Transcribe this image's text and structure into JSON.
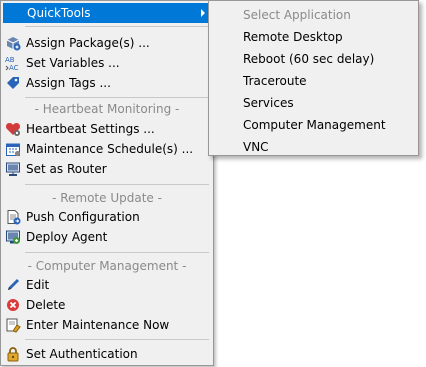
{
  "menu": {
    "quicktools": "QuickTools",
    "assign_packages": "Assign Package(s) ...",
    "set_variables": "Set Variables ...",
    "assign_tags": "Assign Tags ...",
    "heartbeat_header": "- Heartbeat Monitoring -",
    "heartbeat_settings": "Heartbeat Settings ...",
    "maintenance_schedule": "Maintenance Schedule(s) ...",
    "set_as_router": "Set as Router",
    "remote_update_header": "- Remote Update -",
    "push_configuration": "Push Configuration",
    "deploy_agent": "Deploy Agent",
    "computer_mgmt_header": "- Computer Management -",
    "edit": "Edit",
    "delete": "Delete",
    "enter_maintenance": "Enter Maintenance Now",
    "set_authentication": "Set Authentication"
  },
  "submenu": {
    "select_application": "Select Application",
    "remote_desktop": "Remote Desktop",
    "reboot": "Reboot (60 sec delay)",
    "traceroute": "Traceroute",
    "services": "Services",
    "computer_management": "Computer Management",
    "vnc": "VNC"
  },
  "colors": {
    "highlight": "#0078d7",
    "menu_bg": "#f0f0f0",
    "disabled_text": "#8a8a8a"
  }
}
